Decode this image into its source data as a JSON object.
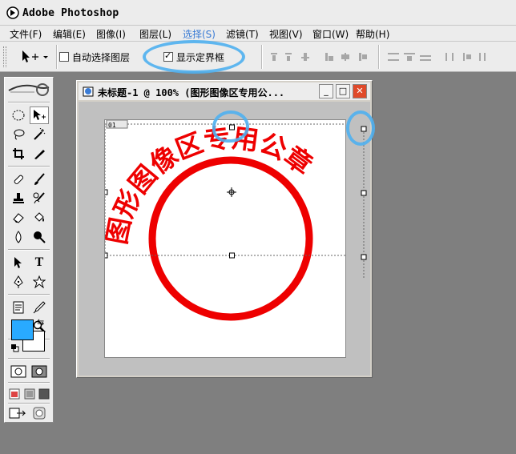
{
  "app": {
    "title": "Adobe Photoshop"
  },
  "menu": [
    {
      "label": "文件(F)"
    },
    {
      "label": "编辑(E)"
    },
    {
      "label": "图像(I)"
    },
    {
      "label": "图层(L)"
    },
    {
      "label": "选择(S)"
    },
    {
      "label": "滤镜(T)"
    },
    {
      "label": "视图(V)"
    },
    {
      "label": "窗口(W)"
    },
    {
      "label": "帮助(H)"
    }
  ],
  "options": {
    "auto_select_label": "自动选择图层",
    "auto_select_checked": false,
    "show_bounding_label": "显示定界框",
    "show_bounding_checked": true
  },
  "document": {
    "title": "未标题-1 @ 100% (图形图像区专用公...",
    "layer_badge": "01",
    "seal_text": "图形图像区专用公章"
  },
  "colors": {
    "foreground": "#29aaff",
    "background": "#ffffff",
    "seal": "#ee0000",
    "highlight": "#4fb0f0"
  },
  "icons": {
    "tools": [
      "rect-marquee-icon",
      "move-icon",
      "lasso-icon",
      "magic-wand-icon",
      "crop-icon",
      "slice-icon",
      "healing-brush-icon",
      "brush-icon",
      "clone-stamp-icon",
      "history-brush-icon",
      "eraser-icon",
      "paint-bucket-icon",
      "blur-icon",
      "dodge-icon",
      "path-select-icon",
      "type-icon",
      "pen-icon",
      "custom-shape-icon",
      "notes-icon",
      "eyedropper-icon",
      "hand-icon",
      "zoom-icon"
    ]
  }
}
